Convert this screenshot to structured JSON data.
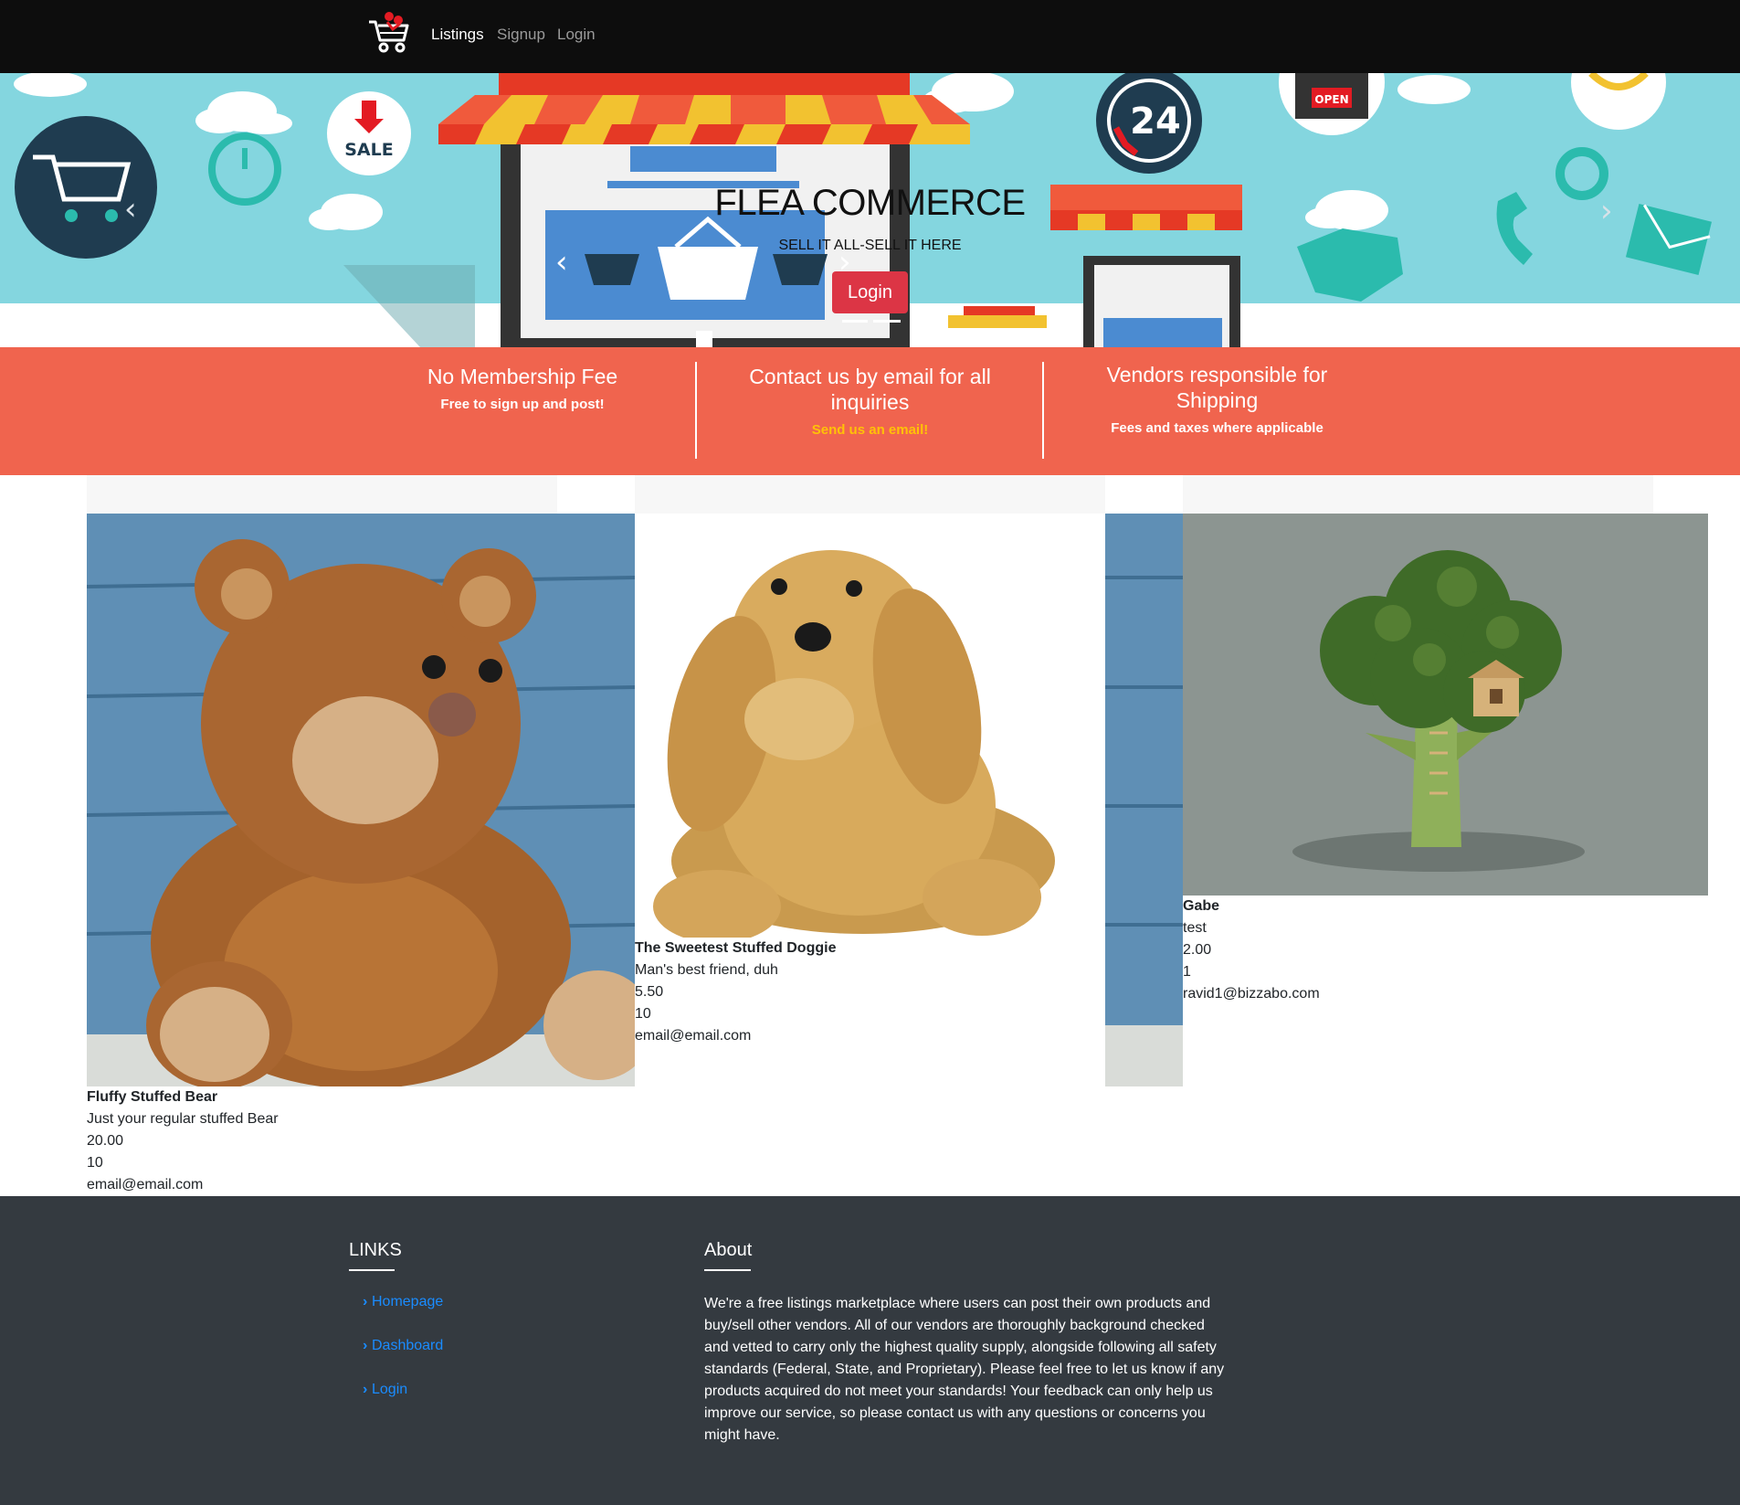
{
  "navbar": {
    "logo_icon": "shopping-cart-logo-icon",
    "links": [
      "Listings",
      "Signup",
      "Login"
    ]
  },
  "hero": {
    "title": "FLEA COMMERCE",
    "subtitle": "SELL IT ALL-SELL IT HERE",
    "button": "Login",
    "sale_badge": "SALE",
    "badge_24": "24",
    "open_sign": "OPEN",
    "prev_icon": "chevron-left-icon",
    "next_icon": "chevron-right-icon"
  },
  "features": [
    {
      "title": "No Membership Fee",
      "subtitle": "Free to sign up and post!"
    },
    {
      "title": "Contact us by email for all inquiries",
      "subtitle": "Send us an email!"
    },
    {
      "title": "Vendors responsible for Shipping",
      "subtitle": "Fees and taxes where applicable"
    }
  ],
  "listings": [
    {
      "name": "Fluffy Stuffed Bear",
      "description": "Just your regular stuffed Bear",
      "price": "20.00",
      "quantity": "10",
      "email": "email@email.com"
    },
    {
      "name": "The Sweetest Stuffed Doggie",
      "description": "Man's best friend, duh",
      "price": "5.50",
      "quantity": "10",
      "email": "email@email.com"
    },
    {
      "name": "Gabe",
      "description": "test",
      "price": "2.00",
      "quantity": "1",
      "email": "ravid1@bizzabo.com"
    }
  ],
  "footer": {
    "links_heading": "LINKS",
    "links": [
      "Homepage",
      "Dashboard",
      "Login"
    ],
    "about_heading": "About",
    "about_text": "We're a free listings marketplace where users can post their own products and buy/sell other vendors. All of our vendors are thoroughly background checked and vetted to carry only the highest quality supply, alongside following all safety standards (Federal, State, and Proprietary). Please feel free to let us know if any products acquired do not meet your standards! Your feedback can only help us improve our service, so please contact us with any questions or concerns you might have."
  },
  "colors": {
    "navbar": "#0d0d0d",
    "hero_sky": "#84d6df",
    "band": "#f0644e",
    "accent_yellow": "#ffc107",
    "button_red": "#dc3545",
    "footer": "#343a40",
    "link_blue": "#1a8cff"
  }
}
